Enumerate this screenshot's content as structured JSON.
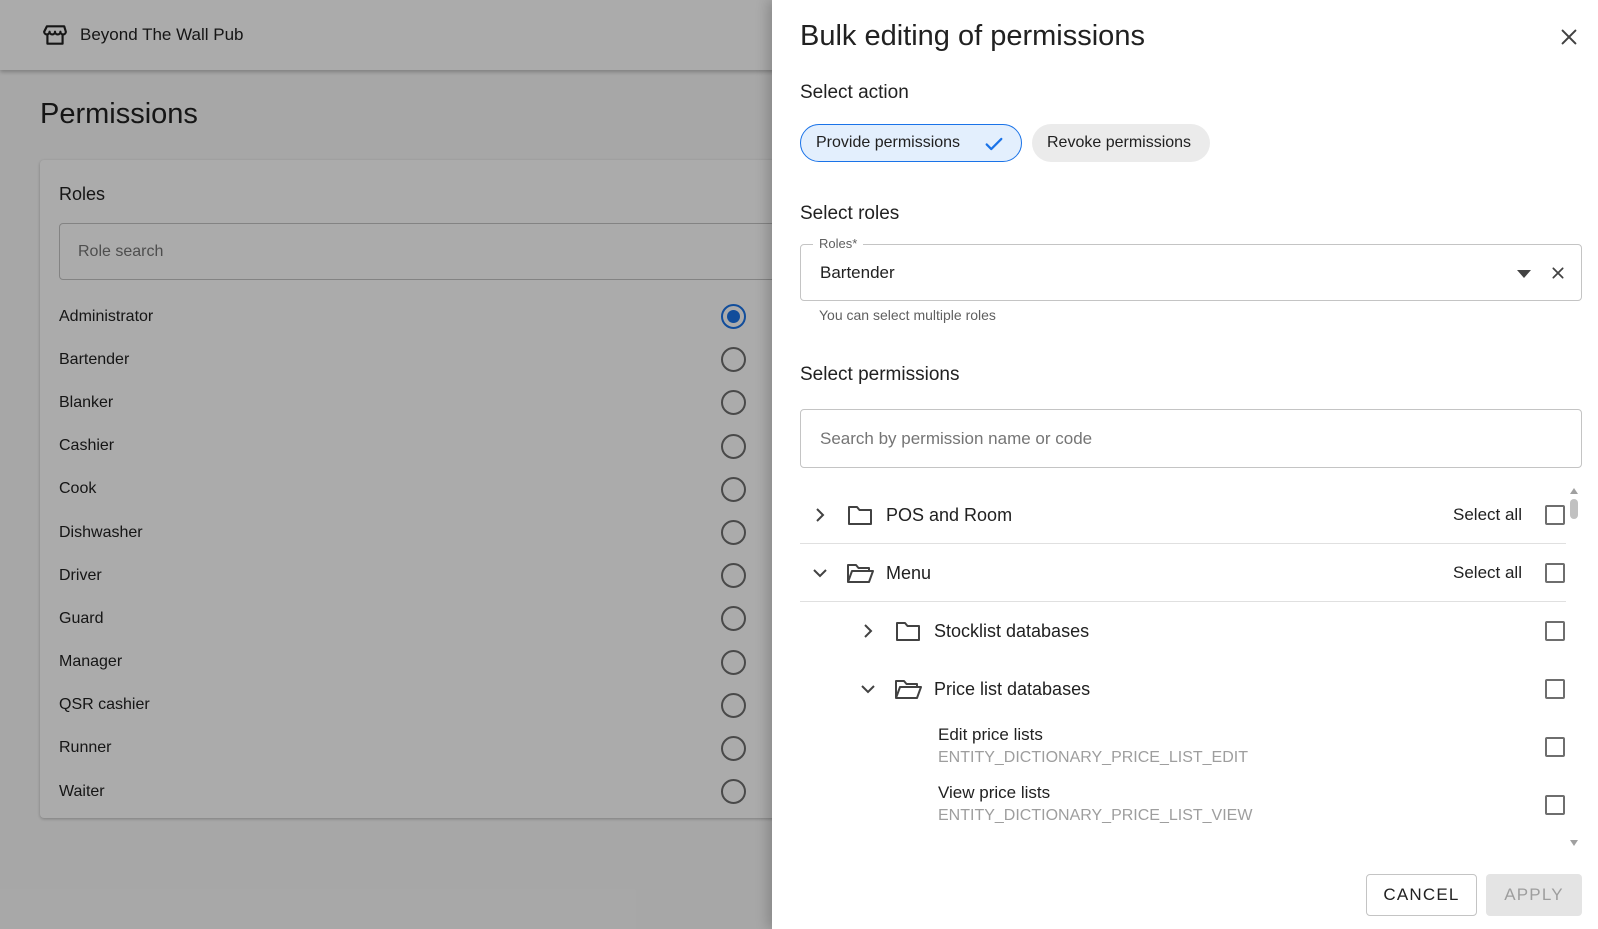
{
  "background": {
    "venue_name": "Beyond The Wall Pub",
    "page_title": "Permissions",
    "roles_card": {
      "title": "Roles",
      "search_placeholder": "Role search",
      "roles": [
        {
          "label": "Administrator",
          "selected": true
        },
        {
          "label": "Bartender",
          "selected": false
        },
        {
          "label": "Blanker",
          "selected": false
        },
        {
          "label": "Cashier",
          "selected": false
        },
        {
          "label": "Cook",
          "selected": false
        },
        {
          "label": "Dishwasher",
          "selected": false
        },
        {
          "label": "Driver",
          "selected": false
        },
        {
          "label": "Guard",
          "selected": false
        },
        {
          "label": "Manager",
          "selected": false
        },
        {
          "label": "QSR cashier",
          "selected": false
        },
        {
          "label": "Runner",
          "selected": false
        },
        {
          "label": "Waiter",
          "selected": false
        }
      ]
    }
  },
  "dialog": {
    "title": "Bulk editing of permissions",
    "select_action": {
      "label": "Select action",
      "options": [
        {
          "label": "Provide permissions",
          "selected": true
        },
        {
          "label": "Revoke permissions",
          "selected": false
        }
      ]
    },
    "select_roles": {
      "label": "Select roles",
      "field_label": "Roles*",
      "value": "Bartender",
      "helper": "You can select multiple roles"
    },
    "select_permissions": {
      "label": "Select permissions",
      "search_placeholder": "Search by permission name or code",
      "select_all_label": "Select all",
      "tree": {
        "pos_and_room": "POS and Room",
        "menu": "Menu",
        "stocklist_databases": "Stocklist databases",
        "price_list_databases": "Price list databases",
        "edit_price_lists": {
          "name": "Edit price lists",
          "code": "ENTITY_DICTIONARY_PRICE_LIST_EDIT"
        },
        "view_price_lists": {
          "name": "View price lists",
          "code": "ENTITY_DICTIONARY_PRICE_LIST_VIEW"
        }
      }
    },
    "buttons": {
      "cancel": "CANCEL",
      "apply": "APPLY"
    }
  },
  "colors": {
    "accent": "#1a73e8",
    "chip_selected_bg": "#e3effd",
    "overlay": "#000000"
  },
  "icons": {
    "store": "store-icon",
    "close": "close-icon",
    "check": "check-icon",
    "dropdown": "arrow-drop-down-icon",
    "clear": "clear-icon",
    "folder": "folder-icon",
    "folder_open": "folder-open-icon",
    "chevron_right": "chevron-right-icon",
    "chevron_down": "chevron-down-icon"
  }
}
